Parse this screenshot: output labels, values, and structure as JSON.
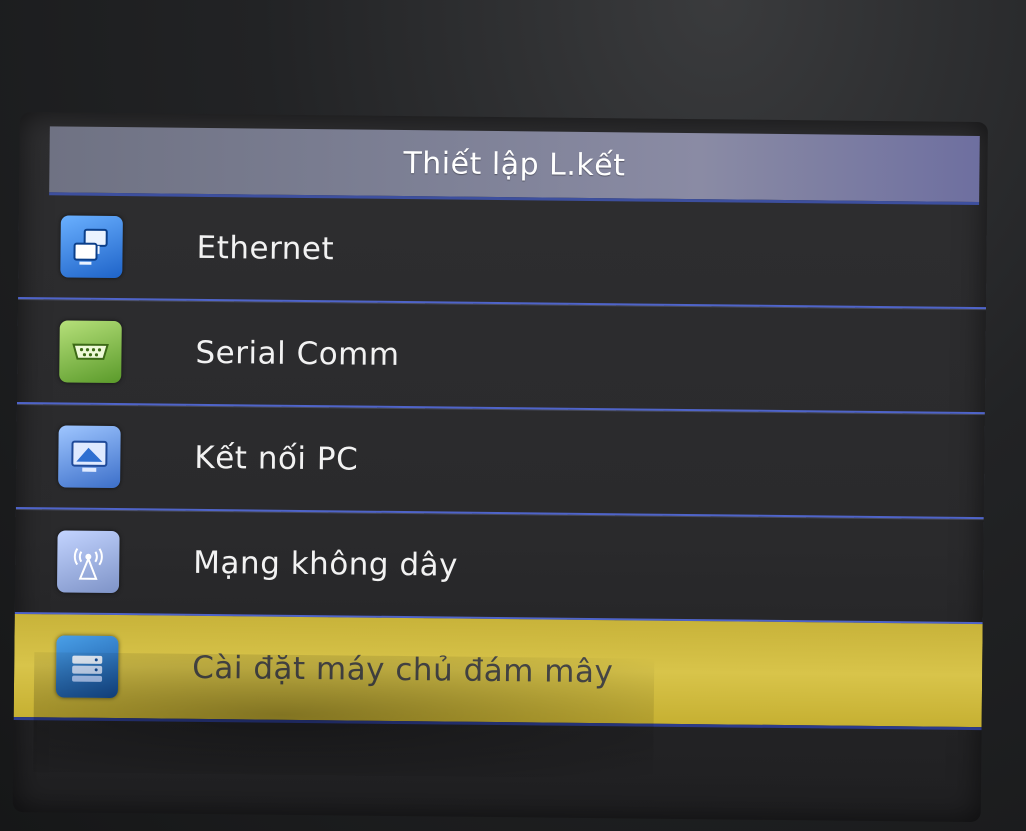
{
  "title": "Thiết lập L.kết",
  "menu": {
    "items": [
      {
        "label": "Ethernet",
        "icon": "network-computers-icon"
      },
      {
        "label": "Serial Comm",
        "icon": "serial-port-icon"
      },
      {
        "label": "Kết nối PC",
        "icon": "pc-connection-icon"
      },
      {
        "label": "Mạng không dây",
        "icon": "wireless-antenna-icon"
      },
      {
        "label": "Cài đặt máy chủ đám mây",
        "icon": "cloud-server-icon",
        "selected": true
      }
    ]
  },
  "colors": {
    "title_bar": "#7d8095",
    "divider": "#4f64c9",
    "selection": "#d8c44a",
    "text": "#f2f2f2"
  }
}
